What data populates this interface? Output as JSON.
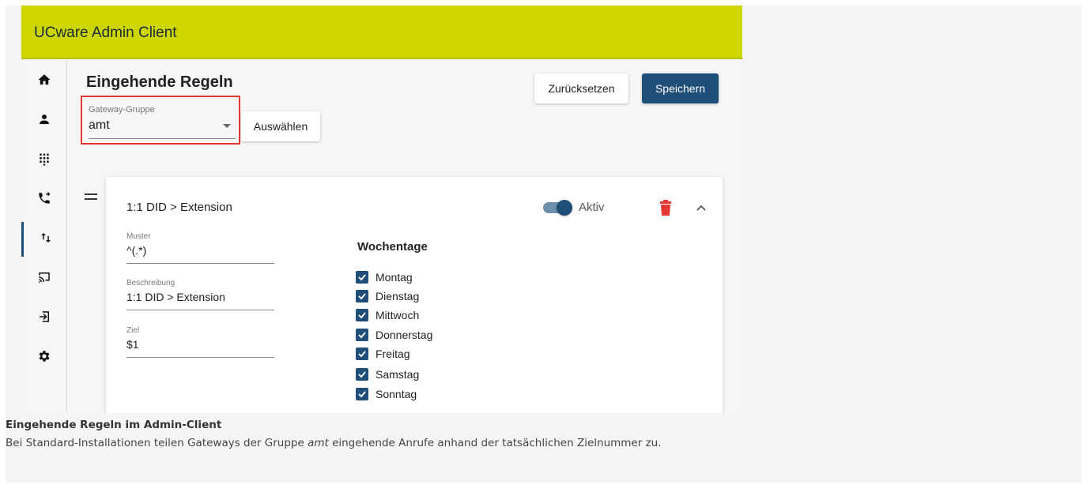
{
  "app": {
    "title": "UCware Admin Client"
  },
  "sidebar": {
    "items": [
      {
        "icon": "home-icon"
      },
      {
        "icon": "user-icon"
      },
      {
        "icon": "dialpad-icon"
      },
      {
        "icon": "phone-forward-icon"
      },
      {
        "icon": "swap-vertical-icon",
        "active": true
      },
      {
        "icon": "cast-icon"
      },
      {
        "icon": "login-icon"
      },
      {
        "icon": "gear-icon"
      }
    ]
  },
  "page": {
    "title": "Eingehende Regeln",
    "gateway_group": {
      "label": "Gateway-Gruppe",
      "value": "amt"
    },
    "select_button": "Auswählen",
    "reset_button": "Zurücksetzen",
    "save_button": "Speichern"
  },
  "rule": {
    "title": "1:1 DID > Extension",
    "active_label": "Aktiv",
    "active": true,
    "fields": [
      {
        "label": "Muster",
        "value": "^(.*)"
      },
      {
        "label": "Beschreibung",
        "value": "1:1 DID > Extension"
      },
      {
        "label": "Ziel",
        "value": "$1"
      }
    ],
    "weekdays_title": "Wochentage",
    "weekdays": [
      {
        "label": "Montag",
        "checked": true
      },
      {
        "label": "Dienstag",
        "checked": true
      },
      {
        "label": "Mittwoch",
        "checked": true
      },
      {
        "label": "Donnerstag",
        "checked": true
      },
      {
        "label": "Freitag",
        "checked": true
      },
      {
        "label": "Samstag",
        "checked": true
      },
      {
        "label": "Sonntag",
        "checked": true
      }
    ]
  },
  "caption": {
    "title": "Eingehende Regeln im Admin-Client",
    "text_before": "Bei Standard-Installationen teilen Gateways der Gruppe ",
    "text_emphasis": "amt",
    "text_after": " eingehende Anrufe anhand der tatsächlichen Zielnummer zu."
  },
  "colors": {
    "brand": "#cdd600",
    "primary": "#1f4e79",
    "danger": "#e53935",
    "highlight": "#e53935"
  }
}
